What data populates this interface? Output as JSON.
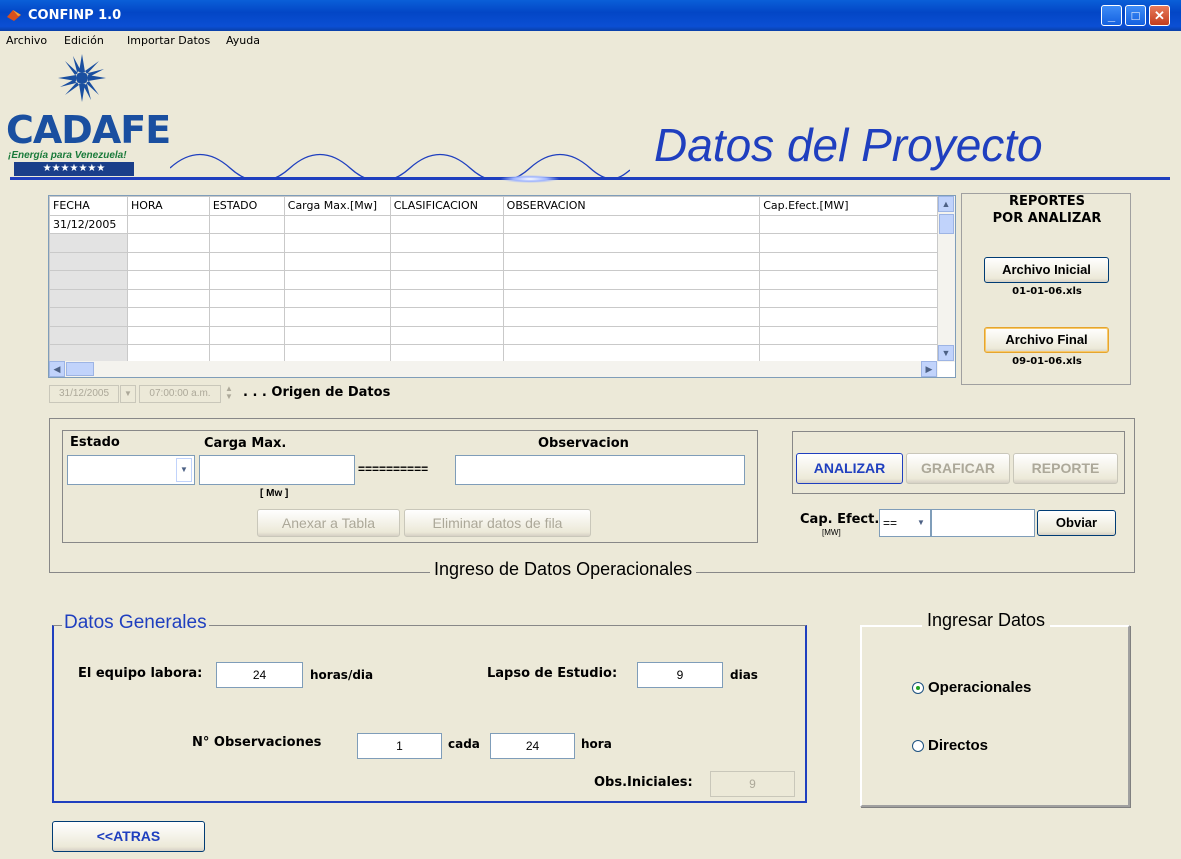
{
  "window": {
    "title": "CONFINP 1.0"
  },
  "menu": [
    "Archivo",
    "Edición",
    "Importar Datos",
    "Ayuda"
  ],
  "logo": {
    "name": "CADAFE",
    "tagline": "¡Energía para Venezuela!",
    "stars": "★★★★★★★"
  },
  "page_title": "Datos del Proyecto",
  "table": {
    "columns": [
      "FECHA",
      "HORA",
      "ESTADO",
      "Carga Max.[Mw]",
      "CLASIFICACION",
      "OBSERVACION",
      "Cap.Efect.[MW]"
    ],
    "rows": [
      [
        "31/12/2005",
        "",
        "",
        "",
        "",
        "",
        ""
      ],
      [
        "",
        "",
        "",
        "",
        "",
        "",
        ""
      ],
      [
        "",
        "",
        "",
        "",
        "",
        "",
        ""
      ],
      [
        "",
        "",
        "",
        "",
        "",
        "",
        ""
      ],
      [
        "",
        "",
        "",
        "",
        "",
        "",
        ""
      ],
      [
        "",
        "",
        "",
        "",
        "",
        "",
        ""
      ],
      [
        "",
        "",
        "",
        "",
        "",
        "",
        ""
      ],
      [
        "",
        "",
        "",
        "",
        "",
        "",
        ""
      ]
    ]
  },
  "origin": {
    "date": "31/12/2005",
    "time": "07:00:00 a.m.",
    "label": ". . . Origen de Datos"
  },
  "reports": {
    "title_line1": "REPORTES",
    "title_line2": "POR ANALIZAR",
    "initial_button": "Archivo Inicial",
    "initial_file": "01-01-06.xls",
    "final_button": "Archivo Final",
    "final_file": "09-01-06.xls"
  },
  "ops": {
    "estado_label": "Estado",
    "carga_label": "Carga Max.",
    "carga_unit": "[ Mw ]",
    "separator": "==========",
    "obs_label": "Observacion",
    "anexar": "Anexar a Tabla",
    "eliminar": "Eliminar datos de fila",
    "analizar": "ANALIZAR",
    "graficar": "GRAFICAR",
    "reporte": "REPORTE",
    "cap_label": "Cap. Efect.",
    "cap_unit": "[MW]",
    "cap_op": "==",
    "obviar": "Obviar",
    "section_title": "Ingreso de Datos Operacionales"
  },
  "general": {
    "title": "Datos Generales",
    "equipo_label": "El equipo labora:",
    "equipo_value": "24",
    "equipo_unit": "horas/dia",
    "lapso_label": "Lapso de Estudio:",
    "lapso_value": "9",
    "lapso_unit": "dias",
    "nobs_label": "N° Observaciones",
    "nobs_value": "1",
    "cada_label": "cada",
    "cada_value": "24",
    "cada_unit": "hora",
    "obsini_label": "Obs.Iniciales:",
    "obsini_value": "9"
  },
  "ingresar": {
    "title": "Ingresar Datos",
    "opt1": "Operacionales",
    "opt2": "Directos",
    "selected": "Operacionales"
  },
  "back_button": "<<ATRAS",
  "colors": {
    "title_blue": "#1f3fbf",
    "frame_blue": "#1f3fbf",
    "xp_blue": "#0346c6"
  }
}
